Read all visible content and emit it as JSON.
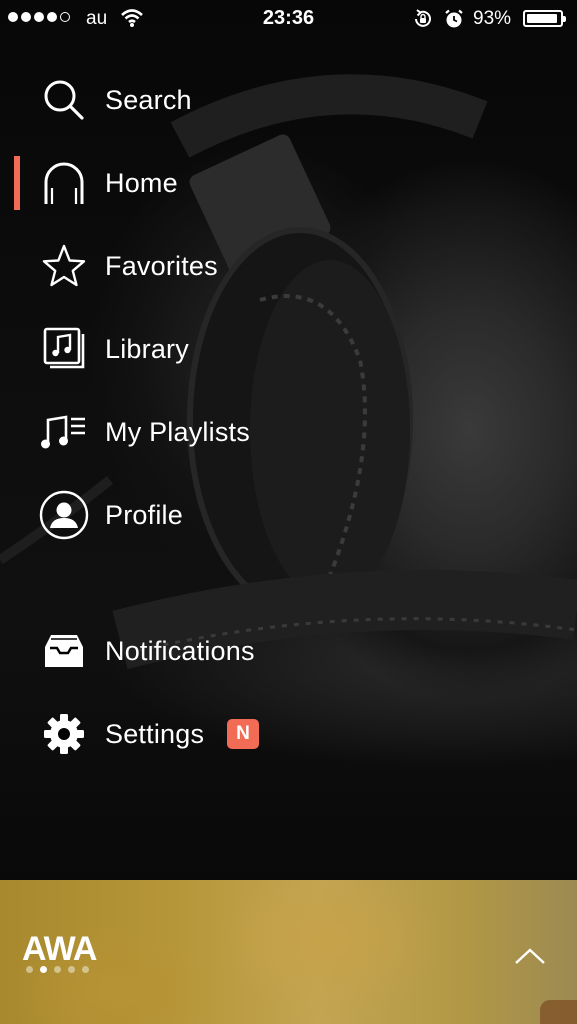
{
  "status_bar": {
    "carrier": "au",
    "time": "23:36",
    "battery_percent": "93%",
    "battery_level": 0.93,
    "signal_bars_filled": 4,
    "signal_bars_total": 5
  },
  "menu": {
    "items": [
      {
        "label": "Search",
        "icon": "search-icon",
        "active": false
      },
      {
        "label": "Home",
        "icon": "headphones-icon",
        "active": true
      },
      {
        "label": "Favorites",
        "icon": "star-icon",
        "active": false
      },
      {
        "label": "Library",
        "icon": "music-library-icon",
        "active": false
      },
      {
        "label": "My Playlists",
        "icon": "playlist-icon",
        "active": false
      },
      {
        "label": "Profile",
        "icon": "user-icon",
        "active": false
      },
      {
        "label": "Notifications",
        "icon": "inbox-icon",
        "active": false
      },
      {
        "label": "Settings",
        "icon": "gear-icon",
        "active": false,
        "badge": "N"
      }
    ]
  },
  "player": {
    "logo": "AWA",
    "page_count": 5,
    "current_page": 2
  },
  "colors": {
    "accent": "#f26c55",
    "player_bar": "#b59638"
  }
}
